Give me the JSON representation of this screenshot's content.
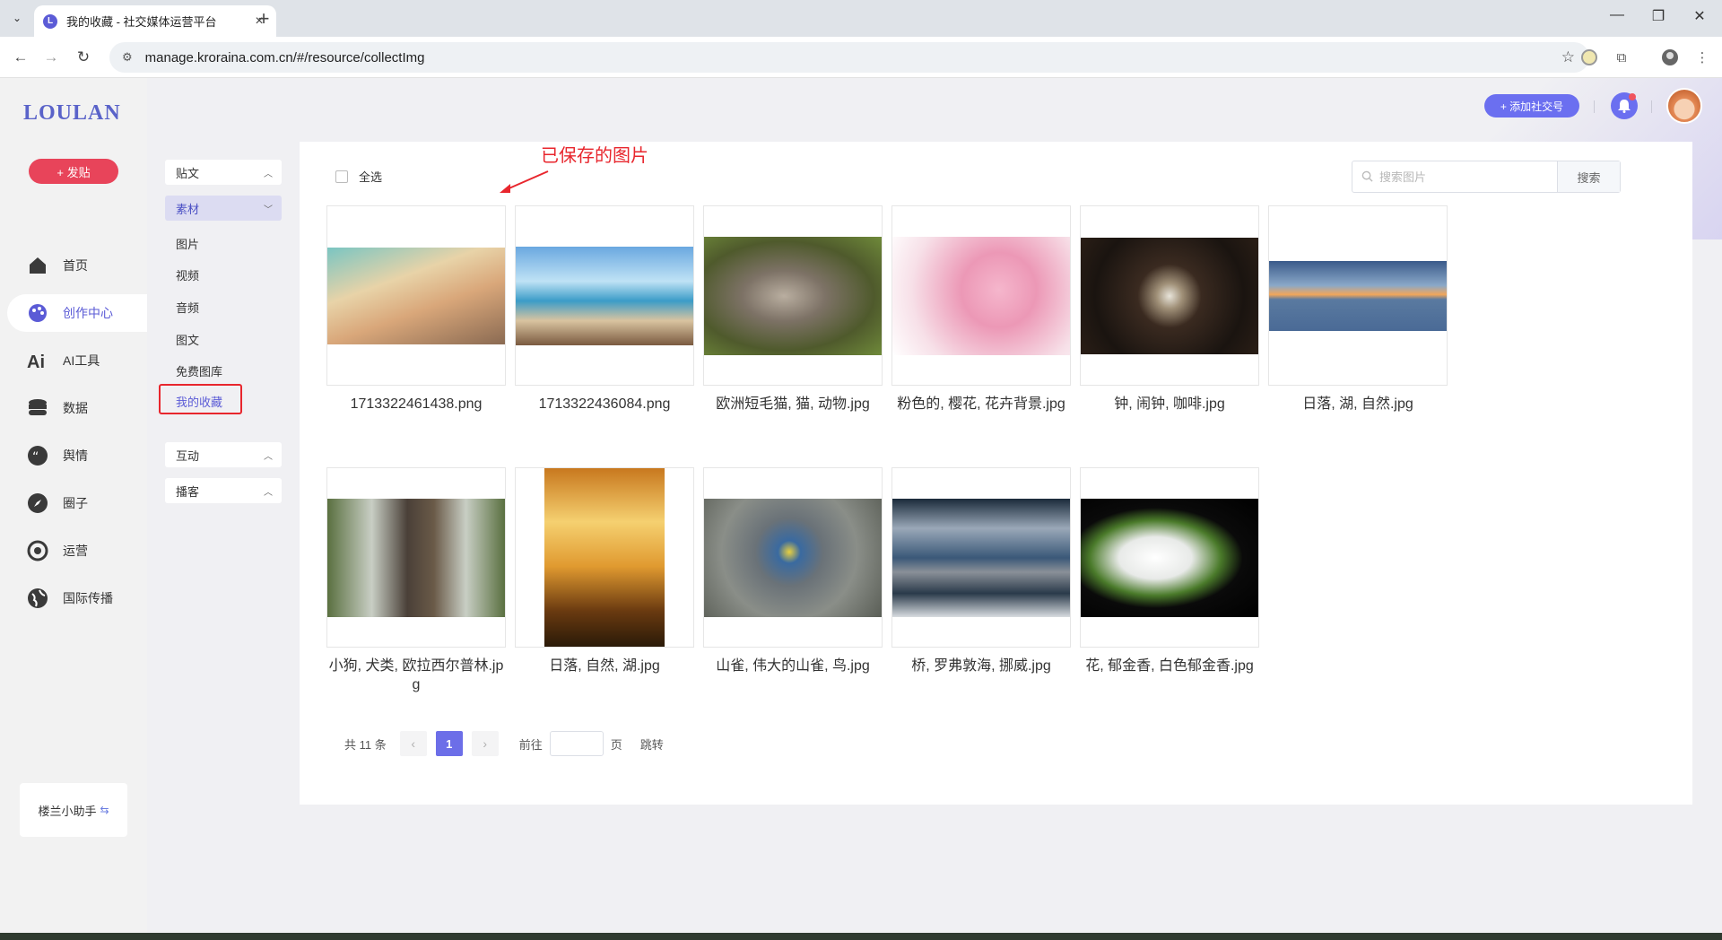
{
  "browser": {
    "tab_title": "我的收藏 - 社交媒体运营平台",
    "url": "manage.kroraina.com.cn/#/resource/collectImg"
  },
  "app": {
    "logo": "LOULAN",
    "post_button": "+ 发贴",
    "nav": [
      {
        "label": "首页",
        "icon": "home-icon"
      },
      {
        "label": "创作中心",
        "icon": "palette-icon"
      },
      {
        "label": "AI工具",
        "icon": "ai-icon"
      },
      {
        "label": "数据",
        "icon": "database-icon"
      },
      {
        "label": "舆情",
        "icon": "quote-icon"
      },
      {
        "label": "圈子",
        "icon": "compass-icon"
      },
      {
        "label": "运营",
        "icon": "operation-icon"
      },
      {
        "label": "国际传播",
        "icon": "globe-icon"
      }
    ],
    "helper": "楼兰小助手",
    "header": {
      "add_account": "+ 添加社交号"
    }
  },
  "submenu": {
    "groups": {
      "posts": "贴文",
      "material": "素材",
      "interact": "互动",
      "broadcast": "播客"
    },
    "material_items": [
      "图片",
      "视频",
      "音频",
      "图文",
      "免费图库",
      "我的收藏"
    ]
  },
  "content": {
    "select_all": "全选",
    "search_placeholder": "搜索图片",
    "search_button": "搜索",
    "annotation": "已保存的图片",
    "images": [
      {
        "name": "1713322461438.png"
      },
      {
        "name": "1713322436084.png"
      },
      {
        "name": "欧洲短毛猫, 猫, 动物.jpg"
      },
      {
        "name": "粉色的, 樱花, 花卉背景.jpg"
      },
      {
        "name": "钟, 闹钟, 咖啡.jpg"
      },
      {
        "name": "日落, 湖, 自然.jpg"
      },
      {
        "name": "小狗, 犬类, 欧拉西尔普林.jpg"
      },
      {
        "name": "日落, 自然, 湖.jpg"
      },
      {
        "name": "山雀, 伟大的山雀, 鸟.jpg"
      },
      {
        "name": "桥, 罗弗敦海, 挪威.jpg"
      },
      {
        "name": "花, 郁金香, 白色郁金香.jpg"
      }
    ],
    "pagination": {
      "total_text": "共 11 条",
      "current_page": "1",
      "goto_prefix": "前往",
      "goto_suffix": "页",
      "jump": "跳转"
    }
  }
}
